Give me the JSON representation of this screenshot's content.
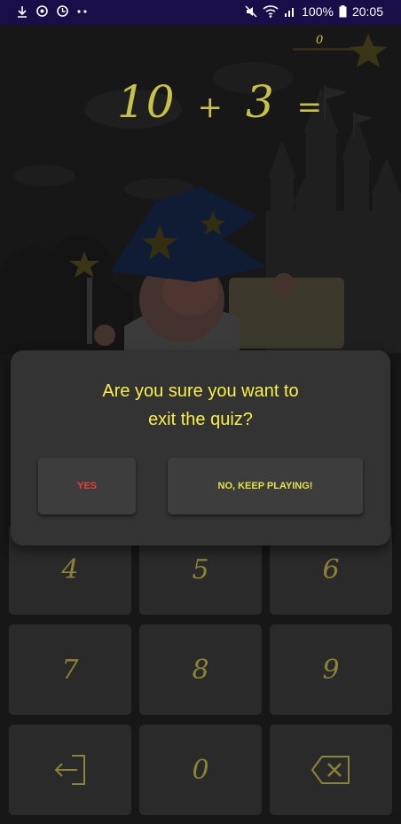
{
  "status_bar": {
    "left_icons": [
      "download-icon",
      "sync-icon",
      "timer-icon",
      "more-dots-icon"
    ],
    "right_icons": [
      "mute-icon",
      "wifi-icon",
      "signal-icon",
      "battery-icon"
    ],
    "battery": "100%",
    "time": "20:05"
  },
  "quiz": {
    "score": "0",
    "operand_a": "10",
    "operator": "+",
    "operand_b": "3",
    "equals": "="
  },
  "dialog": {
    "message_line1": "Are you sure you want to",
    "message_line2": "exit the quiz?",
    "yes_label": "YES",
    "no_label": "NO, KEEP PLAYING!"
  },
  "keypad": {
    "keys": [
      "4",
      "5",
      "6",
      "7",
      "8",
      "9",
      "exit-icon",
      "0",
      "backspace-icon"
    ]
  },
  "colors": {
    "status_bar": "#1a0e48",
    "accent_yellow": "#f7ef4a",
    "yes_red": "#e8423a",
    "dialog_bg": "#333333"
  }
}
